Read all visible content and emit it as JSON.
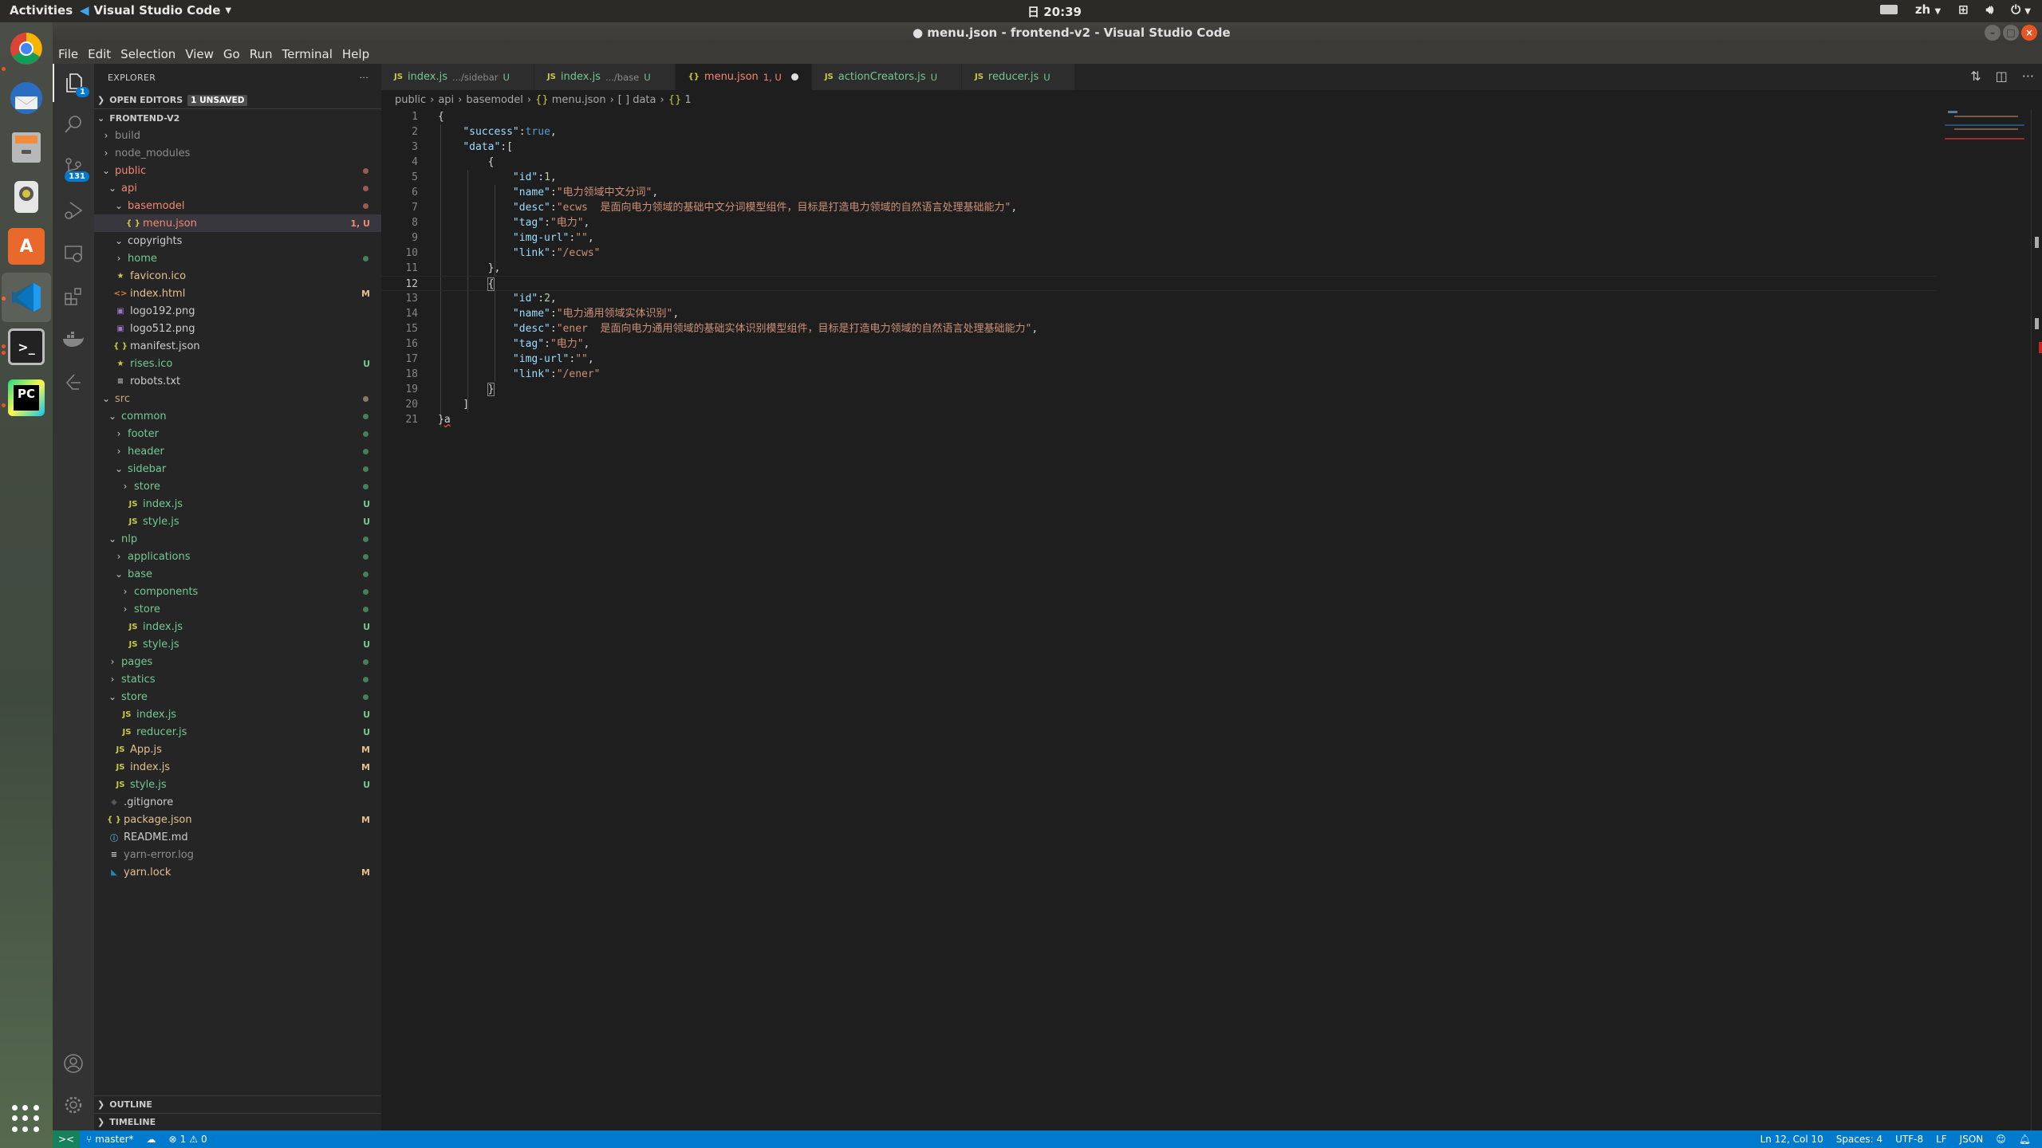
{
  "system": {
    "activities": "Activities",
    "app_name": "Visual Studio Code",
    "clock": "日 20:39",
    "language": "zh"
  },
  "window": {
    "title": "● menu.json - frontend-v2 - Visual Studio Code"
  },
  "menu": [
    "File",
    "Edit",
    "Selection",
    "View",
    "Go",
    "Run",
    "Terminal",
    "Help"
  ],
  "dock": [
    {
      "name": "chrome",
      "label": "",
      "running": true
    },
    {
      "name": "thunderbird",
      "label": "",
      "running": false
    },
    {
      "name": "files",
      "label": "",
      "running": false
    },
    {
      "name": "rhythmbox",
      "label": "",
      "running": false
    },
    {
      "name": "software",
      "label": "A",
      "running": false
    },
    {
      "name": "vscode",
      "label": "",
      "running": true
    },
    {
      "name": "terminal",
      "label": ">_",
      "running": true
    },
    {
      "name": "pycharm",
      "label": "PC",
      "running": true
    }
  ],
  "activity_bar": {
    "explorer_badge": "1",
    "scm_badge": "131"
  },
  "sidebar": {
    "title": "EXPLORER",
    "more": "···",
    "open_editors": "OPEN EDITORS",
    "unsaved_badge": "1 UNSAVED",
    "root": "FRONTEND-V2",
    "tree": [
      {
        "label": "build",
        "depth": 0,
        "type": "folder",
        "open": false,
        "color": "#8c8c8c",
        "deco": "",
        "deco_color": "",
        "dot": ""
      },
      {
        "label": "node_modules",
        "depth": 0,
        "type": "folder",
        "open": false,
        "color": "#8c8c8c",
        "deco": "",
        "deco_color": "",
        "dot": ""
      },
      {
        "label": "public",
        "depth": 0,
        "type": "folder",
        "open": true,
        "color": "#f48771",
        "deco": "",
        "deco_color": "",
        "dot": "#9c5a50"
      },
      {
        "label": "api",
        "depth": 1,
        "type": "folder",
        "open": true,
        "color": "#f48771",
        "deco": "",
        "deco_color": "",
        "dot": "#9c5a50"
      },
      {
        "label": "basemodel",
        "depth": 2,
        "type": "folder",
        "open": true,
        "color": "#f48771",
        "deco": "",
        "deco_color": "",
        "dot": "#9c5a50"
      },
      {
        "label": "menu.json",
        "depth": 3,
        "type": "json",
        "open": false,
        "color": "#f48771",
        "deco": "1, U",
        "deco_color": "#f48771",
        "dot": "",
        "selected": true
      },
      {
        "label": "copyrights",
        "depth": 2,
        "type": "folder",
        "open": true,
        "color": "#cccccc",
        "deco": "",
        "deco_color": "",
        "dot": ""
      },
      {
        "label": "home",
        "depth": 2,
        "type": "folder",
        "open": false,
        "color": "#73c991",
        "deco": "",
        "deco_color": "",
        "dot": "#487e5a"
      },
      {
        "label": "favicon.ico",
        "depth": 1,
        "type": "star",
        "open": false,
        "color": "#e2c08d",
        "deco": "",
        "deco_color": "",
        "dot": ""
      },
      {
        "label": "index.html",
        "depth": 1,
        "type": "html",
        "open": false,
        "color": "#e2c08d",
        "deco": "M",
        "deco_color": "#e2c08d",
        "dot": ""
      },
      {
        "label": "logo192.png",
        "depth": 1,
        "type": "image",
        "open": false,
        "color": "#cccccc",
        "deco": "",
        "deco_color": "",
        "dot": ""
      },
      {
        "label": "logo512.png",
        "depth": 1,
        "type": "image",
        "open": false,
        "color": "#cccccc",
        "deco": "",
        "deco_color": "",
        "dot": ""
      },
      {
        "label": "manifest.json",
        "depth": 1,
        "type": "json",
        "open": false,
        "color": "#cccccc",
        "deco": "",
        "deco_color": "",
        "dot": ""
      },
      {
        "label": "rises.ico",
        "depth": 1,
        "type": "star",
        "open": false,
        "color": "#73c991",
        "deco": "U",
        "deco_color": "#73c991",
        "dot": ""
      },
      {
        "label": "robots.txt",
        "depth": 1,
        "type": "text",
        "open": false,
        "color": "#cccccc",
        "deco": "",
        "deco_color": "",
        "dot": ""
      },
      {
        "label": "src",
        "depth": 0,
        "type": "folder",
        "open": true,
        "color": "#c9a77f",
        "deco": "",
        "deco_color": "",
        "dot": "#8a7a64"
      },
      {
        "label": "common",
        "depth": 1,
        "type": "folder",
        "open": true,
        "color": "#73c991",
        "deco": "",
        "deco_color": "",
        "dot": "#487e5a"
      },
      {
        "label": "footer",
        "depth": 2,
        "type": "folder",
        "open": false,
        "color": "#73c991",
        "deco": "",
        "deco_color": "",
        "dot": "#487e5a"
      },
      {
        "label": "header",
        "depth": 2,
        "type": "folder",
        "open": false,
        "color": "#73c991",
        "deco": "",
        "deco_color": "",
        "dot": "#487e5a"
      },
      {
        "label": "sidebar",
        "depth": 2,
        "type": "folder",
        "open": true,
        "color": "#73c991",
        "deco": "",
        "deco_color": "",
        "dot": "#487e5a"
      },
      {
        "label": "store",
        "depth": 3,
        "type": "folder",
        "open": false,
        "color": "#73c991",
        "deco": "",
        "deco_color": "",
        "dot": "#487e5a"
      },
      {
        "label": "index.js",
        "depth": 3,
        "type": "js",
        "open": false,
        "color": "#73c991",
        "deco": "U",
        "deco_color": "#73c991",
        "dot": ""
      },
      {
        "label": "style.js",
        "depth": 3,
        "type": "js",
        "open": false,
        "color": "#73c991",
        "deco": "U",
        "deco_color": "#73c991",
        "dot": ""
      },
      {
        "label": "nlp",
        "depth": 1,
        "type": "folder",
        "open": true,
        "color": "#73c991",
        "deco": "",
        "deco_color": "",
        "dot": "#487e5a"
      },
      {
        "label": "applications",
        "depth": 2,
        "type": "folder",
        "open": false,
        "color": "#73c991",
        "deco": "",
        "deco_color": "",
        "dot": "#487e5a"
      },
      {
        "label": "base",
        "depth": 2,
        "type": "folder",
        "open": true,
        "color": "#73c991",
        "deco": "",
        "deco_color": "",
        "dot": "#487e5a"
      },
      {
        "label": "components",
        "depth": 3,
        "type": "folder",
        "open": false,
        "color": "#73c991",
        "deco": "",
        "deco_color": "",
        "dot": "#487e5a"
      },
      {
        "label": "store",
        "depth": 3,
        "type": "folder",
        "open": false,
        "color": "#73c991",
        "deco": "",
        "deco_color": "",
        "dot": "#487e5a"
      },
      {
        "label": "index.js",
        "depth": 3,
        "type": "js",
        "open": false,
        "color": "#73c991",
        "deco": "U",
        "deco_color": "#73c991",
        "dot": ""
      },
      {
        "label": "style.js",
        "depth": 3,
        "type": "js",
        "open": false,
        "color": "#73c991",
        "deco": "U",
        "deco_color": "#73c991",
        "dot": ""
      },
      {
        "label": "pages",
        "depth": 1,
        "type": "folder",
        "open": false,
        "color": "#73c991",
        "deco": "",
        "deco_color": "",
        "dot": "#487e5a"
      },
      {
        "label": "statics",
        "depth": 1,
        "type": "folder",
        "open": false,
        "color": "#73c991",
        "deco": "",
        "deco_color": "",
        "dot": "#487e5a"
      },
      {
        "label": "store",
        "depth": 1,
        "type": "folder",
        "open": true,
        "color": "#73c991",
        "deco": "",
        "deco_color": "",
        "dot": "#487e5a"
      },
      {
        "label": "index.js",
        "depth": 2,
        "type": "js",
        "open": false,
        "color": "#73c991",
        "deco": "U",
        "deco_color": "#73c991",
        "dot": ""
      },
      {
        "label": "reducer.js",
        "depth": 2,
        "type": "js",
        "open": false,
        "color": "#73c991",
        "deco": "U",
        "deco_color": "#73c991",
        "dot": ""
      },
      {
        "label": "App.js",
        "depth": 1,
        "type": "js",
        "open": false,
        "color": "#e2c08d",
        "deco": "M",
        "deco_color": "#e2c08d",
        "dot": ""
      },
      {
        "label": "index.js",
        "depth": 1,
        "type": "js",
        "open": false,
        "color": "#e2c08d",
        "deco": "M",
        "deco_color": "#e2c08d",
        "dot": ""
      },
      {
        "label": "style.js",
        "depth": 1,
        "type": "js",
        "open": false,
        "color": "#73c991",
        "deco": "U",
        "deco_color": "#73c991",
        "dot": ""
      },
      {
        "label": ".gitignore",
        "depth": 0,
        "type": "git",
        "open": false,
        "color": "#cccccc",
        "deco": "",
        "deco_color": "",
        "dot": ""
      },
      {
        "label": "package.json",
        "depth": 0,
        "type": "json",
        "open": false,
        "color": "#e2c08d",
        "deco": "M",
        "deco_color": "#e2c08d",
        "dot": ""
      },
      {
        "label": "README.md",
        "depth": 0,
        "type": "info",
        "open": false,
        "color": "#cccccc",
        "deco": "",
        "deco_color": "",
        "dot": ""
      },
      {
        "label": "yarn-error.log",
        "depth": 0,
        "type": "text",
        "open": false,
        "color": "#8c8c8c",
        "deco": "",
        "deco_color": "",
        "dot": ""
      },
      {
        "label": "yarn.lock",
        "depth": 0,
        "type": "yarn",
        "open": false,
        "color": "#e2c08d",
        "deco": "M",
        "deco_color": "#e2c08d",
        "dot": ""
      }
    ],
    "outline": "OUTLINE",
    "timeline": "TIMELINE"
  },
  "tabs": [
    {
      "icon": "JS",
      "name": "index.js",
      "desc": ".../sidebar",
      "status": "U",
      "color": "#73c991",
      "active": false,
      "dirty": false
    },
    {
      "icon": "JS",
      "name": "index.js",
      "desc": ".../base",
      "status": "U",
      "color": "#73c991",
      "active": false,
      "dirty": false
    },
    {
      "icon": "{}",
      "name": "menu.json",
      "desc": "",
      "status": "1, U",
      "color": "#f48771",
      "active": true,
      "dirty": true
    },
    {
      "icon": "JS",
      "name": "actionCreators.js",
      "desc": "",
      "status": "U",
      "color": "#73c991",
      "active": false,
      "dirty": false
    },
    {
      "icon": "JS",
      "name": "reducer.js",
      "desc": "",
      "status": "U",
      "color": "#73c991",
      "active": false,
      "dirty": false
    }
  ],
  "breadcrumbs": [
    "public",
    "api",
    "basemodel",
    "{} menu.json",
    "[ ] data",
    "{} 1"
  ],
  "editor": {
    "current_line": 12,
    "lines": [
      [
        [
          "p",
          "{"
        ]
      ],
      [
        [
          "p",
          "    "
        ],
        [
          "k",
          "\"success\""
        ],
        [
          "p",
          ":"
        ],
        [
          "b",
          "true"
        ],
        [
          "p",
          ","
        ]
      ],
      [
        [
          "p",
          "    "
        ],
        [
          "k",
          "\"data\""
        ],
        [
          "p",
          ":["
        ]
      ],
      [
        [
          "p",
          "        {"
        ]
      ],
      [
        [
          "p",
          "            "
        ],
        [
          "k",
          "\"id\""
        ],
        [
          "p",
          ":"
        ],
        [
          "n",
          "1"
        ],
        [
          "p",
          ","
        ]
      ],
      [
        [
          "p",
          "            "
        ],
        [
          "k",
          "\"name\""
        ],
        [
          "p",
          ":"
        ],
        [
          "s",
          "\"电力领域中文分词\""
        ],
        [
          "p",
          ","
        ]
      ],
      [
        [
          "p",
          "            "
        ],
        [
          "k",
          "\"desc\""
        ],
        [
          "p",
          ":"
        ],
        [
          "s",
          "\"ecws  是面向电力领域的基础中文分词模型组件，目标是打造电力领域的自然语言处理基础能力\""
        ],
        [
          "p",
          ","
        ]
      ],
      [
        [
          "p",
          "            "
        ],
        [
          "k",
          "\"tag\""
        ],
        [
          "p",
          ":"
        ],
        [
          "s",
          "\"电力\""
        ],
        [
          "p",
          ","
        ]
      ],
      [
        [
          "p",
          "            "
        ],
        [
          "k",
          "\"img-url\""
        ],
        [
          "p",
          ":"
        ],
        [
          "s",
          "\"\""
        ],
        [
          "p",
          ","
        ]
      ],
      [
        [
          "p",
          "            "
        ],
        [
          "k",
          "\"link\""
        ],
        [
          "p",
          ":"
        ],
        [
          "s",
          "\"/ecws\""
        ]
      ],
      [
        [
          "p",
          "        },"
        ]
      ],
      [
        [
          "p",
          "        "
        ],
        [
          "bx",
          "{"
        ]
      ],
      [
        [
          "p",
          "            "
        ],
        [
          "k",
          "\"id\""
        ],
        [
          "p",
          ":"
        ],
        [
          "n",
          "2"
        ],
        [
          "p",
          ","
        ]
      ],
      [
        [
          "p",
          "            "
        ],
        [
          "k",
          "\"name\""
        ],
        [
          "p",
          ":"
        ],
        [
          "s",
          "\"电力通用领域实体识别\""
        ],
        [
          "p",
          ","
        ]
      ],
      [
        [
          "p",
          "            "
        ],
        [
          "k",
          "\"desc\""
        ],
        [
          "p",
          ":"
        ],
        [
          "s",
          "\"ener  是面向电力通用领域的基础实体识别模型组件，目标是打造电力领域的自然语言处理基础能力\""
        ],
        [
          "p",
          ","
        ]
      ],
      [
        [
          "p",
          "            "
        ],
        [
          "k",
          "\"tag\""
        ],
        [
          "p",
          ":"
        ],
        [
          "s",
          "\"电力\""
        ],
        [
          "p",
          ","
        ]
      ],
      [
        [
          "p",
          "            "
        ],
        [
          "k",
          "\"img-url\""
        ],
        [
          "p",
          ":"
        ],
        [
          "s",
          "\"\""
        ],
        [
          "p",
          ","
        ]
      ],
      [
        [
          "p",
          "            "
        ],
        [
          "k",
          "\"link\""
        ],
        [
          "p",
          ":"
        ],
        [
          "s",
          "\"/ener\""
        ]
      ],
      [
        [
          "p",
          "        "
        ],
        [
          "bx",
          "}"
        ]
      ],
      [
        [
          "p",
          "    ]"
        ]
      ],
      [
        [
          "p",
          "}"
        ],
        [
          "err",
          "a"
        ]
      ]
    ]
  },
  "statusbar": {
    "branch": "master*",
    "errors": "1",
    "warnings": "0",
    "position": "Ln 12, Col 10",
    "indent": "Spaces: 4",
    "encoding": "UTF-8",
    "eol": "LF",
    "language": "JSON"
  }
}
